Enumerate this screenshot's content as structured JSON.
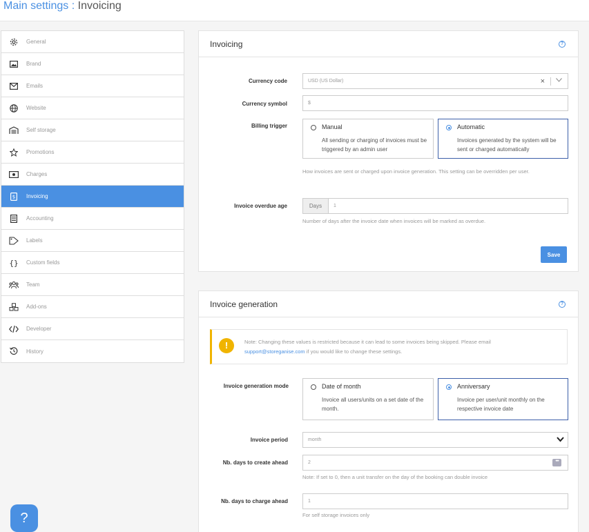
{
  "header": {
    "crumb": "Main settings",
    "sep": ":",
    "current": "Invoicing"
  },
  "sidebar": {
    "items": [
      {
        "label": "General",
        "icon": "gear-icon"
      },
      {
        "label": "Brand",
        "icon": "image-icon"
      },
      {
        "label": "Emails",
        "icon": "envelope-icon"
      },
      {
        "label": "Website",
        "icon": "globe-icon"
      },
      {
        "label": "Self storage",
        "icon": "warehouse-icon"
      },
      {
        "label": "Promotions",
        "icon": "star-icon"
      },
      {
        "label": "Charges",
        "icon": "money-icon"
      },
      {
        "label": "Invoicing",
        "icon": "invoice-icon",
        "active": true
      },
      {
        "label": "Accounting",
        "icon": "calculator-icon"
      },
      {
        "label": "Labels",
        "icon": "tag-icon"
      },
      {
        "label": "Custom fields",
        "icon": "braces-icon"
      },
      {
        "label": "Team",
        "icon": "team-icon"
      },
      {
        "label": "Add-ons",
        "icon": "cubes-icon"
      },
      {
        "label": "Developer",
        "icon": "code-icon"
      },
      {
        "label": "History",
        "icon": "history-icon"
      }
    ]
  },
  "invoicing": {
    "title": "Invoicing",
    "currency_label": "Currency code",
    "currency_value": "USD  (US Dollar)",
    "symbol_label": "Currency symbol",
    "symbol_value": "$",
    "billing_label": "Billing trigger",
    "manual_title": "Manual",
    "manual_desc": "All sending or charging of invoices must be triggered by an admin user",
    "auto_title": "Automatic",
    "auto_desc": "Invoices generated by the system will be sent or charged automatically",
    "billing_hint": "How invoices are sent or charged upon invoice generation.  This setting can be overridden per user.",
    "overdue_label": "Invoice overdue age",
    "overdue_prefix": "Days",
    "overdue_value": "1",
    "overdue_hint": "Number of days after the invoice date when invoices will be marked as overdue.",
    "save_label": "Save"
  },
  "generation": {
    "title": "Invoice generation",
    "note_text": "Note: Changing these values is restricted because it can lead to some invoices being skipped.  Please email",
    "note_email": "support@storeganise.com",
    "note_tail": " if you would like to change these settings.",
    "mode_label": "Invoice generation mode",
    "date_title": "Date of month",
    "date_desc": "Invoice all users/units on a set date of the month.",
    "anniv_title": "Anniversary",
    "anniv_desc": "Invoice per user/unit  monthly on the respective invoice date",
    "period_label": "Invoice period",
    "period_value": "month",
    "create_label": "Nb. days to create ahead",
    "create_value": "2",
    "create_hint": "Note: If set to 0, then a unit transfer on the day of the booking can double invoice",
    "charge_label": "Nb. days to charge ahead",
    "charge_value": "1",
    "charge_hint": "For self storage invoices only"
  },
  "fab": {
    "label": "?"
  }
}
